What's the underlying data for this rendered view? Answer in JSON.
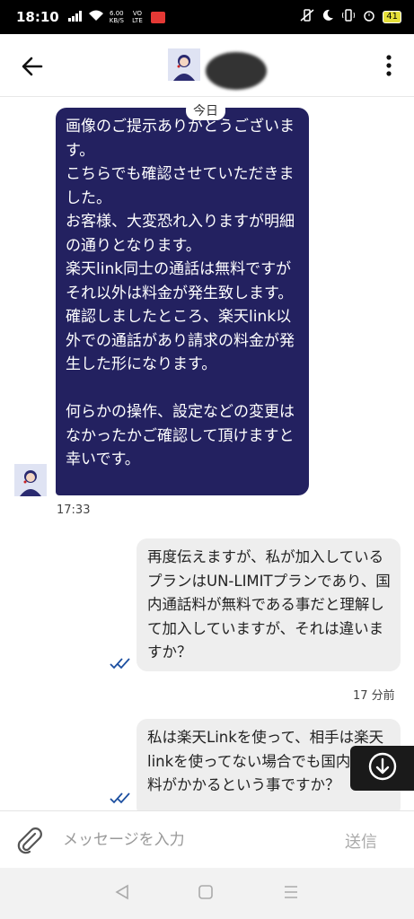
{
  "status_bar": {
    "time": "18:10",
    "net_speed_value": "6.00",
    "net_speed_unit": "KB/S",
    "net_type": "VO LTE",
    "battery": "41"
  },
  "header": {
    "contact_name_hidden": true
  },
  "chat": {
    "date_label": "今日",
    "incoming": {
      "text": "画像のご提示ありがとうございます。\nこちらでも確認させていただきました。\nお客様、大変恐れ入りますが明細の通りとなります。\n楽天link同士の通話は無料ですがそれ以外は料金が発生致します。\n確認しましたところ、楽天link以外での通話があり請求の料金が発生した形になります。\n\n何らかの操作、設定などの変更はなかったかご確認して頂けますと幸いです。",
      "time": "17:33"
    },
    "outgoing": [
      {
        "text": "再度伝えますが、私が加入しているプランはUN-LIMITプランであり、国内通話料が無料である事だと理解して加入していますが、それは違いますか？",
        "time": "17 分前"
      },
      {
        "text": "私は楽天Linkを使って、相手は楽天linkを使ってない場合でも国内通話料がかかるという事ですか？"
      }
    ]
  },
  "input": {
    "placeholder": "メッセージを入力",
    "send_label": "送信"
  },
  "colors": {
    "incoming_bubble": "#232160",
    "outgoing_bubble": "#eeeeee",
    "read_check": "#1c4fa0"
  }
}
